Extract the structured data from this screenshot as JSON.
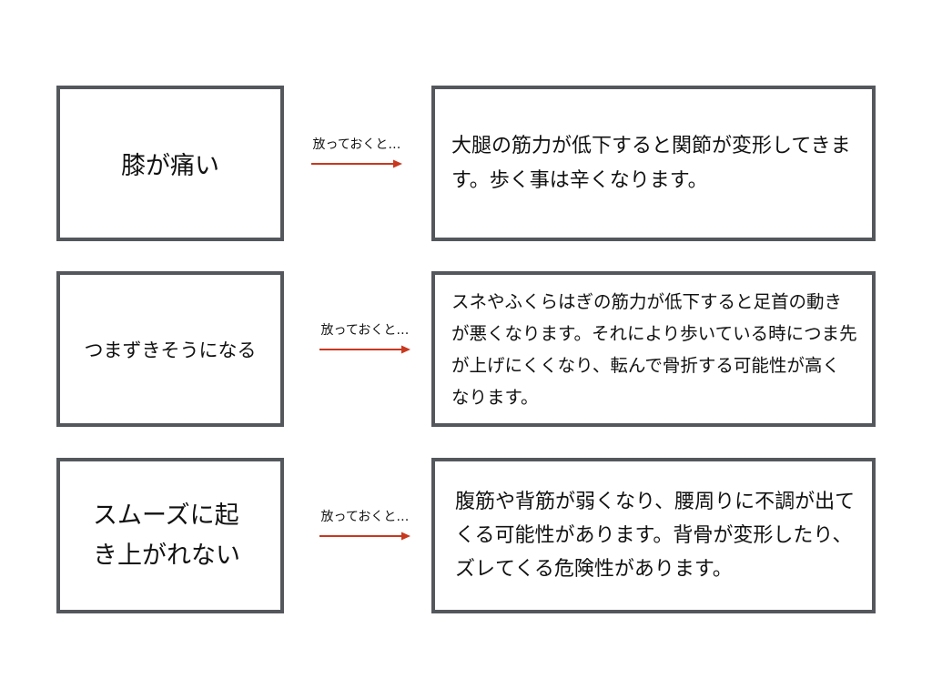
{
  "colors": {
    "box_border": "#54575c",
    "arrow": "#c8381f",
    "text": "#111111"
  },
  "rows": [
    {
      "symptom": "膝が痛い",
      "arrow_label": "放っておくと…",
      "consequence": "大腿の筋力が低下すると関節が変形してきます。歩く事は辛くなります。"
    },
    {
      "symptom": "つまずきそうになる",
      "arrow_label": "放っておくと…",
      "consequence": "スネやふくらはぎの筋力が低下すると足首の動きが悪くなります。それにより歩いている時につま先が上げにくくなり、転んで骨折する可能性が高くなります。"
    },
    {
      "symptom": "スムーズに起き上がれない",
      "arrow_label": "放っておくと…",
      "consequence": "腹筋や背筋が弱くなり、腰周りに不調が出てくる可能性があります。背骨が変形したり、ズレてくる危険性があります。"
    }
  ]
}
